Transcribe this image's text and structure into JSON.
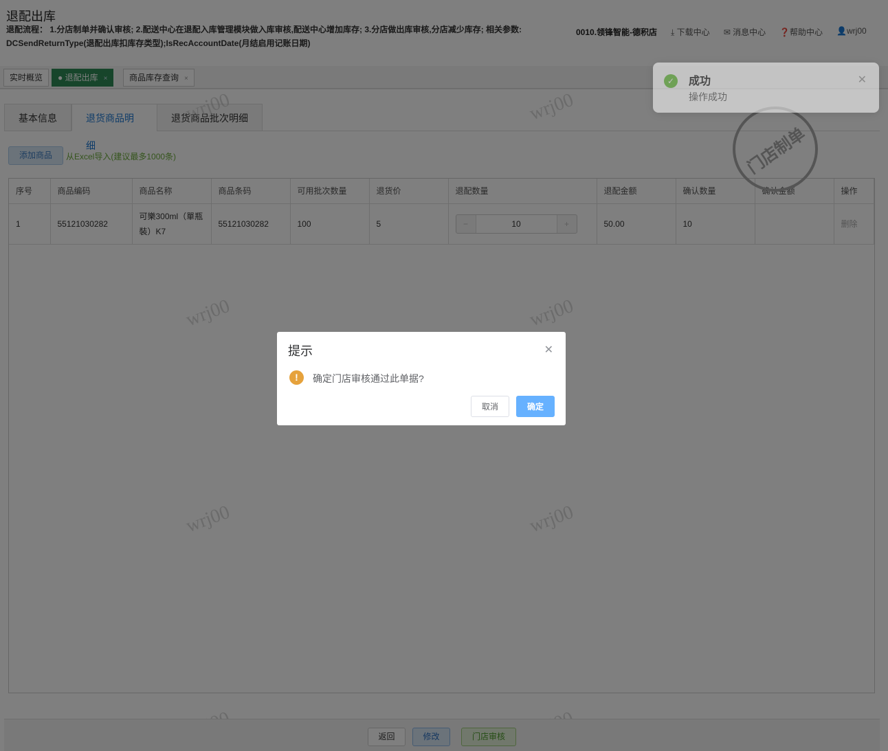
{
  "header": {
    "title": "退配出库",
    "desc": "退配流程： 1.分店制单并确认审核; 2.配送中心在退配入库管理模块做入库审核,配送中心增加库存; 3.分店做出库审核,分店减少库存; 相关参数: DCSendReturnType(退配出库扣库存类型);IsRecAccountDate(月结启用记账日期)",
    "store": "0010.领锋智能-德积店",
    "download": "下载中心",
    "messages": "消息中心",
    "help": "帮助中心",
    "user": "wrj00"
  },
  "page_tabs": [
    {
      "label": "实时概览"
    },
    {
      "label": "退配出库"
    },
    {
      "label": "商品库存查询"
    }
  ],
  "detail_tabs": [
    {
      "label": "基本信息"
    },
    {
      "label": "退货商品明细"
    },
    {
      "label": "退货商品批次明细"
    }
  ],
  "toolbar": {
    "add": "添加商品",
    "excel": "从Excel导入(建议最多1000条)"
  },
  "table": {
    "headers": [
      "序号",
      "商品编码",
      "商品名称",
      "商品条码",
      "可用批次数量",
      "退货价",
      "退配数量",
      "退配金额",
      "确认数量",
      "确认金额",
      "操作"
    ],
    "rows": [
      {
        "no": "1",
        "code": "55121030282",
        "name": "可樂300ml（單瓶裝）K7",
        "barcode": "55121030282",
        "avail": "100",
        "price": "5",
        "qty": "10",
        "amount": "50.00",
        "confirm_qty": "10",
        "confirm_amount": "",
        "action": "删除"
      }
    ]
  },
  "stamp": "门店制单",
  "watermark": "wrj00",
  "footer": {
    "back": "返回",
    "edit": "修改",
    "audit": "门店审核"
  },
  "notification": {
    "title": "成功",
    "message": "操作成功"
  },
  "dialog": {
    "title": "提示",
    "message": "确定门店审核通过此单据?",
    "cancel": "取消",
    "confirm": "确定"
  }
}
